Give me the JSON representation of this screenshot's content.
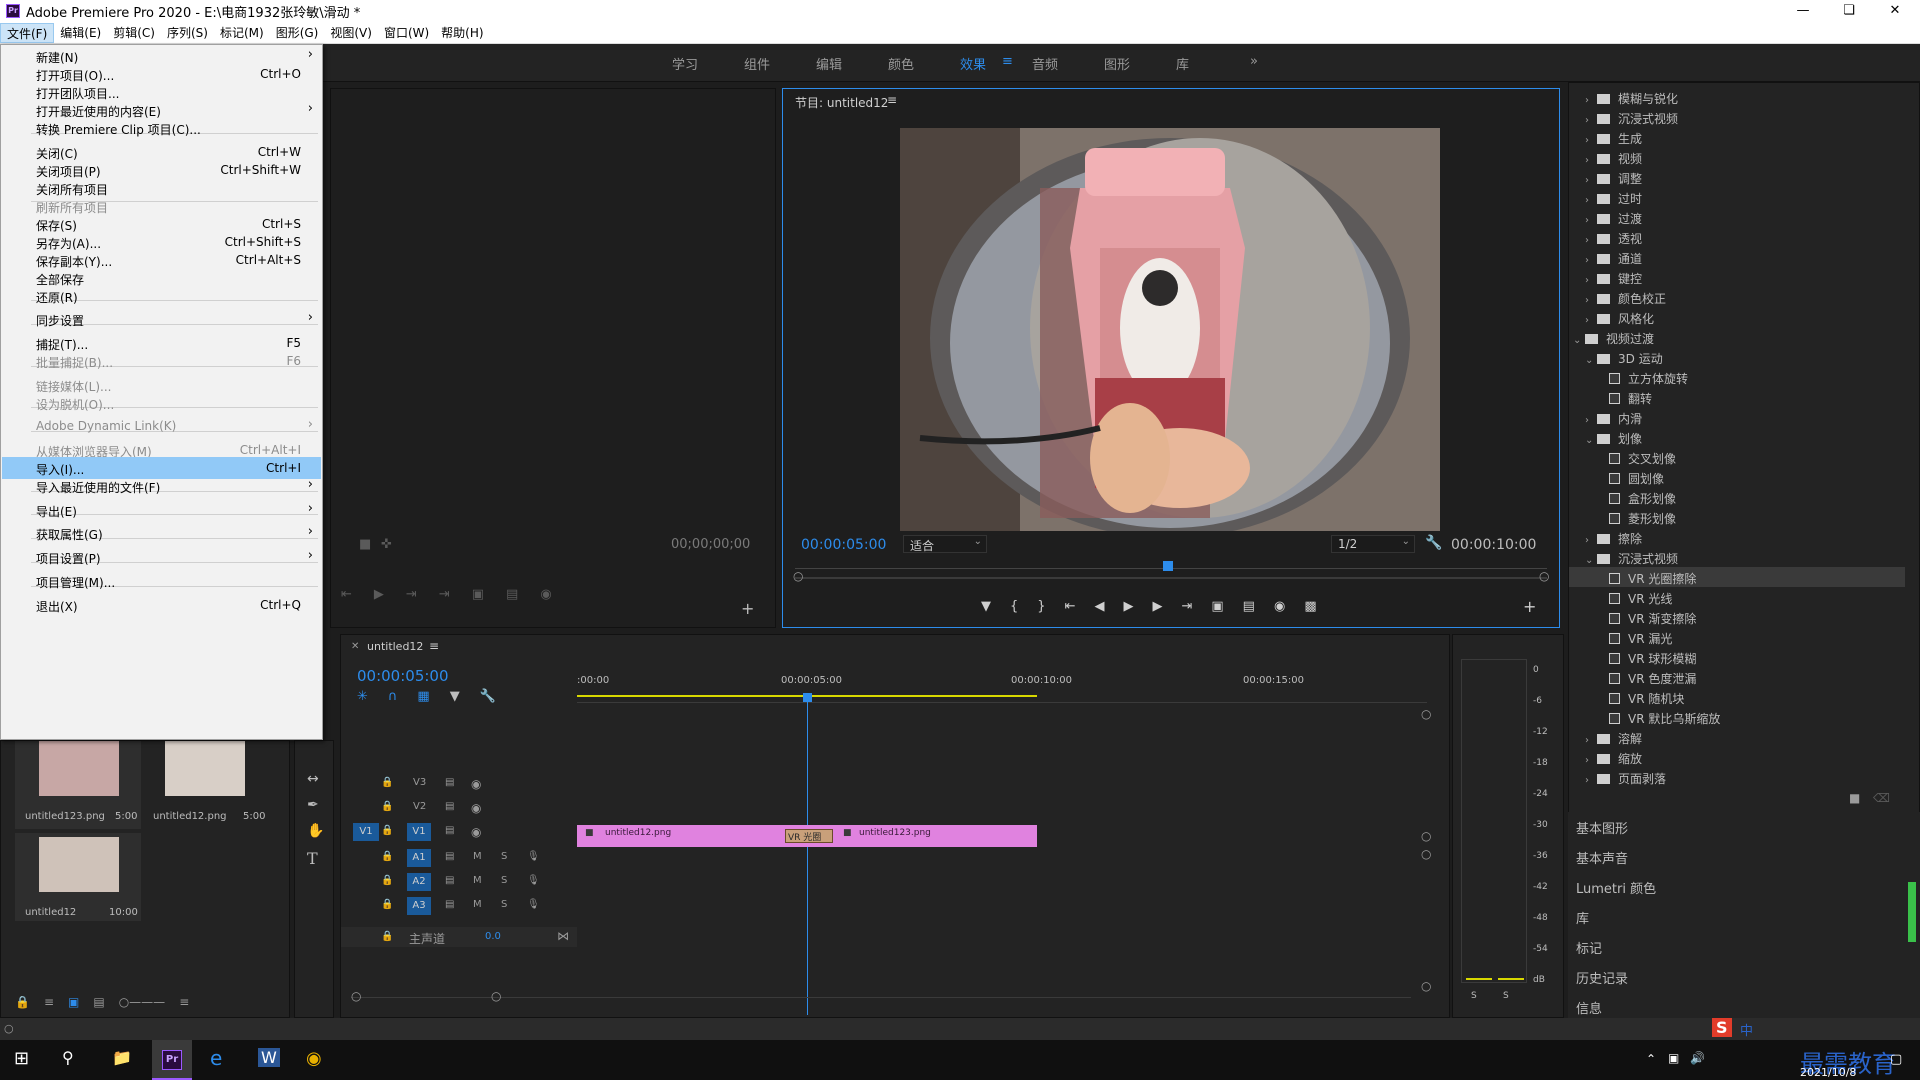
{
  "window": {
    "title": "Adobe Premiere Pro 2020 - E:\\电商1932张玲敏\\滑动 *",
    "app_icon": "Pr"
  },
  "menubar": [
    "文件(F)",
    "编辑(E)",
    "剪辑(C)",
    "序列(S)",
    "标记(M)",
    "图形(G)",
    "视图(V)",
    "窗口(W)",
    "帮助(H)"
  ],
  "workspaces": [
    "学习",
    "组件",
    "编辑",
    "颜色",
    "效果",
    "音频",
    "图形",
    "库"
  ],
  "workspace_active": "效果",
  "file_menu": [
    {
      "label": "新建(N)",
      "shortcut": "",
      "arrow": "›",
      "disabled": false
    },
    {
      "label": "打开项目(O)...",
      "shortcut": "Ctrl+O",
      "arrow": "",
      "disabled": false
    },
    {
      "label": "打开团队项目...",
      "shortcut": "",
      "arrow": "",
      "disabled": false
    },
    {
      "label": "打开最近使用的内容(E)",
      "shortcut": "",
      "arrow": "›",
      "disabled": false
    },
    {
      "label": "转换 Premiere Clip 项目(C)...",
      "shortcut": "",
      "arrow": "",
      "disabled": false
    },
    {
      "label": "关闭(C)",
      "shortcut": "Ctrl+W",
      "arrow": "",
      "disabled": false
    },
    {
      "label": "关闭项目(P)",
      "shortcut": "Ctrl+Shift+W",
      "arrow": "",
      "disabled": false
    },
    {
      "label": "关闭所有项目",
      "shortcut": "",
      "arrow": "",
      "disabled": false
    },
    {
      "label": "刷新所有项目",
      "shortcut": "",
      "arrow": "",
      "disabled": true
    },
    {
      "label": "保存(S)",
      "shortcut": "Ctrl+S",
      "arrow": "",
      "disabled": false
    },
    {
      "label": "另存为(A)...",
      "shortcut": "Ctrl+Shift+S",
      "arrow": "",
      "disabled": false
    },
    {
      "label": "保存副本(Y)...",
      "shortcut": "Ctrl+Alt+S",
      "arrow": "",
      "disabled": false
    },
    {
      "label": "全部保存",
      "shortcut": "",
      "arrow": "",
      "disabled": false
    },
    {
      "label": "还原(R)",
      "shortcut": "",
      "arrow": "",
      "disabled": false
    },
    {
      "label": "同步设置",
      "shortcut": "",
      "arrow": "›",
      "disabled": false
    },
    {
      "label": "捕捉(T)...",
      "shortcut": "F5",
      "arrow": "",
      "disabled": false
    },
    {
      "label": "批量捕捉(B)...",
      "shortcut": "F6",
      "arrow": "",
      "disabled": true
    },
    {
      "label": "链接媒体(L)...",
      "shortcut": "",
      "arrow": "",
      "disabled": true
    },
    {
      "label": "设为脱机(O)...",
      "shortcut": "",
      "arrow": "",
      "disabled": true
    },
    {
      "label": "Adobe Dynamic Link(K)",
      "shortcut": "",
      "arrow": "›",
      "disabled": true
    },
    {
      "label": "从媒体浏览器导入(M)",
      "shortcut": "Ctrl+Alt+I",
      "arrow": "",
      "disabled": true
    },
    {
      "label": "导入(I)...",
      "shortcut": "Ctrl+I",
      "arrow": "",
      "disabled": false
    },
    {
      "label": "导入最近使用的文件(F)",
      "shortcut": "",
      "arrow": "›",
      "disabled": false
    },
    {
      "label": "导出(E)",
      "shortcut": "",
      "arrow": "›",
      "disabled": false
    },
    {
      "label": "获取属性(G)",
      "shortcut": "",
      "arrow": "›",
      "disabled": false
    },
    {
      "label": "项目设置(P)",
      "shortcut": "",
      "arrow": "›",
      "disabled": false
    },
    {
      "label": "项目管理(M)...",
      "shortcut": "",
      "arrow": "",
      "disabled": false
    },
    {
      "label": "退出(X)",
      "shortcut": "Ctrl+Q",
      "arrow": "",
      "disabled": false
    }
  ],
  "source_monitor": {
    "timecode": "00;00;00;00"
  },
  "program_monitor": {
    "tab": "节目: untitled12",
    "timecode": "00:00:05:00",
    "fit": "适合",
    "resolution": "1/2",
    "duration": "00:00:10:00"
  },
  "project": {
    "items": [
      {
        "name": "untitled123.png",
        "duration": "5:00"
      },
      {
        "name": "untitled12.png",
        "duration": "5:00"
      },
      {
        "name": "untitled12",
        "duration": "10:00"
      }
    ]
  },
  "timeline": {
    "tab": "untitled12",
    "timecode": "00:00:05:00",
    "ruler": [
      ":00:00",
      "00:00:05:00",
      "00:00:10:00",
      "00:00:15:00"
    ],
    "video_tracks": [
      "V3",
      "V2",
      "V1"
    ],
    "audio_tracks": [
      "A1",
      "A2",
      "A3"
    ],
    "source_patch": "V1",
    "master": "主声道",
    "master_value": "0.0",
    "clips": [
      "untitled12.png",
      "untitled123.png"
    ],
    "transition": "VR 光圈"
  },
  "meter": {
    "ticks": [
      "0",
      "-6",
      "-12",
      "-18",
      "-24",
      "-30",
      "-36",
      "-42",
      "-48",
      "-54",
      "dB"
    ],
    "solo": [
      "S",
      "S"
    ]
  },
  "effects": {
    "tree": [
      {
        "label": "模糊与锐化",
        "kind": "folder",
        "level": 0,
        "open": false
      },
      {
        "label": "沉浸式视频",
        "kind": "folder",
        "level": 0,
        "open": false
      },
      {
        "label": "生成",
        "kind": "folder",
        "level": 0,
        "open": false
      },
      {
        "label": "视频",
        "kind": "folder",
        "level": 0,
        "open": false
      },
      {
        "label": "调整",
        "kind": "folder",
        "level": 0,
        "open": false
      },
      {
        "label": "过时",
        "kind": "folder",
        "level": 0,
        "open": false
      },
      {
        "label": "过渡",
        "kind": "folder",
        "level": 0,
        "open": false
      },
      {
        "label": "透视",
        "kind": "folder",
        "level": 0,
        "open": false
      },
      {
        "label": "通道",
        "kind": "folder",
        "level": 0,
        "open": false
      },
      {
        "label": "键控",
        "kind": "folder",
        "level": 0,
        "open": false
      },
      {
        "label": "颜色校正",
        "kind": "folder",
        "level": 0,
        "open": false
      },
      {
        "label": "风格化",
        "kind": "folder",
        "level": 0,
        "open": false
      },
      {
        "label": "视频过渡",
        "kind": "folder",
        "level": -1,
        "open": true
      },
      {
        "label": "3D 运动",
        "kind": "folder",
        "level": 0,
        "open": true
      },
      {
        "label": "立方体旋转",
        "kind": "effect",
        "level": 1
      },
      {
        "label": "翻转",
        "kind": "effect",
        "level": 1
      },
      {
        "label": "内滑",
        "kind": "folder",
        "level": 0,
        "open": false
      },
      {
        "label": "划像",
        "kind": "folder",
        "level": 0,
        "open": true
      },
      {
        "label": "交叉划像",
        "kind": "effect",
        "level": 1
      },
      {
        "label": "圆划像",
        "kind": "effect",
        "level": 1
      },
      {
        "label": "盒形划像",
        "kind": "effect",
        "level": 1
      },
      {
        "label": "菱形划像",
        "kind": "effect",
        "level": 1
      },
      {
        "label": "擦除",
        "kind": "folder",
        "level": 0,
        "open": false
      },
      {
        "label": "沉浸式视频",
        "kind": "folder",
        "level": 0,
        "open": true
      },
      {
        "label": "VR 光圈擦除",
        "kind": "effect",
        "level": 1,
        "selected": true
      },
      {
        "label": "VR 光线",
        "kind": "effect",
        "level": 1
      },
      {
        "label": "VR 渐变擦除",
        "kind": "effect",
        "level": 1
      },
      {
        "label": "VR 漏光",
        "kind": "effect",
        "level": 1
      },
      {
        "label": "VR 球形模糊",
        "kind": "effect",
        "level": 1
      },
      {
        "label": "VR 色度泄漏",
        "kind": "effect",
        "level": 1
      },
      {
        "label": "VR 随机块",
        "kind": "effect",
        "level": 1
      },
      {
        "label": "VR 默比乌斯缩放",
        "kind": "effect",
        "level": 1
      },
      {
        "label": "溶解",
        "kind": "folder",
        "level": 0,
        "open": false
      },
      {
        "label": "缩放",
        "kind": "folder",
        "level": 0,
        "open": false
      },
      {
        "label": "页面剥落",
        "kind": "folder",
        "level": 0,
        "open": false
      }
    ],
    "panels": [
      "基本图形",
      "基本声音",
      "Lumetri 颜色",
      "库",
      "标记",
      "历史记录",
      "信息"
    ]
  },
  "taskbar": {
    "date": "2021/10/8",
    "ime": "中",
    "watermark": "最需教育"
  }
}
